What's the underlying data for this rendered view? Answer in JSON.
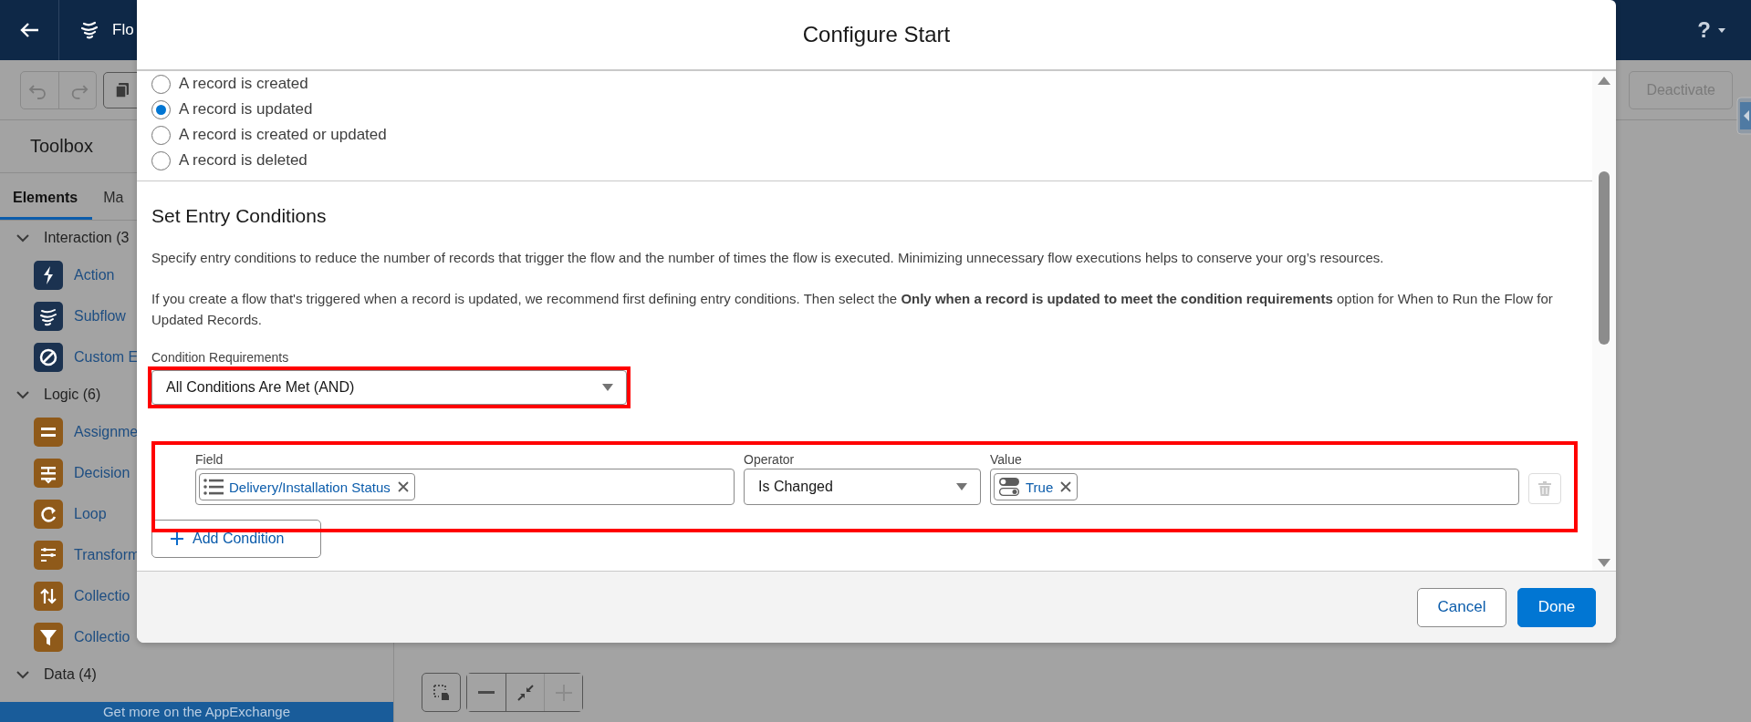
{
  "top_bar": {
    "title": "Flo",
    "help": "?"
  },
  "toolbar": {
    "deactivate_button": {
      "label": "Deactivate",
      "disabled": true
    }
  },
  "sidebar": {
    "title": "Toolbox",
    "tabs": [
      {
        "label": "Elements",
        "selected": true
      },
      {
        "label": "Ma",
        "selected": false
      }
    ],
    "groups": [
      {
        "label": "Interaction (3",
        "expanded": true,
        "children": [
          {
            "label": "Action",
            "color": "#1b3250"
          },
          {
            "label": "Subflow",
            "color": "#1b3250"
          },
          {
            "label": "Custom E",
            "color": "#1b3250"
          }
        ]
      },
      {
        "label": "Logic (6)",
        "expanded": true,
        "children": [
          {
            "label": "Assignme",
            "color": "#8f5a1a"
          },
          {
            "label": "Decision",
            "color": "#8f5a1a"
          },
          {
            "label": "Loop",
            "color": "#8f5a1a"
          },
          {
            "label": "Transform",
            "color": "#8f5a1a"
          },
          {
            "label": "Collectio",
            "color": "#8f5a1a"
          },
          {
            "label": "Collectio",
            "color": "#8f5a1a"
          }
        ]
      },
      {
        "label": "Data (4)",
        "expanded": true
      }
    ],
    "footer_link": "Get more on the AppExchange"
  },
  "modal": {
    "title": "Configure Start",
    "trigger_options": [
      {
        "label": "A record is created",
        "selected": false
      },
      {
        "label": "A record is updated",
        "selected": true
      },
      {
        "label": "A record is created or updated",
        "selected": false
      },
      {
        "label": "A record is deleted",
        "selected": false
      }
    ],
    "section_title": "Set Entry Conditions",
    "description": "Specify entry conditions to reduce the number of records that trigger the flow and the number of times the flow is executed. Minimizing unnecessary flow executions helps to conserve your org’s resources.",
    "note": "If you create a flow that's triggered when a record is updated, we recommend first defining entry conditions. Then select the **Only when a record is updated to meet the condition requirements** option for When to Run the Flow for Updated Records.",
    "condition_requirements": {
      "label": "Condition Requirements",
      "value": "All Conditions Are Met (AND)",
      "highlighted": true
    },
    "conditions": [
      {
        "field_label": "Field",
        "field": "Delivery/Installation Status",
        "operator_label": "Operator",
        "operator": "Is Changed",
        "value_label": "Value",
        "value": "True",
        "highlighted": true
      }
    ],
    "add_condition": "Add Condition",
    "buttons": [
      {
        "label": "Cancel",
        "kind": "neutral"
      },
      {
        "label": "Done",
        "kind": "brand"
      }
    ]
  }
}
